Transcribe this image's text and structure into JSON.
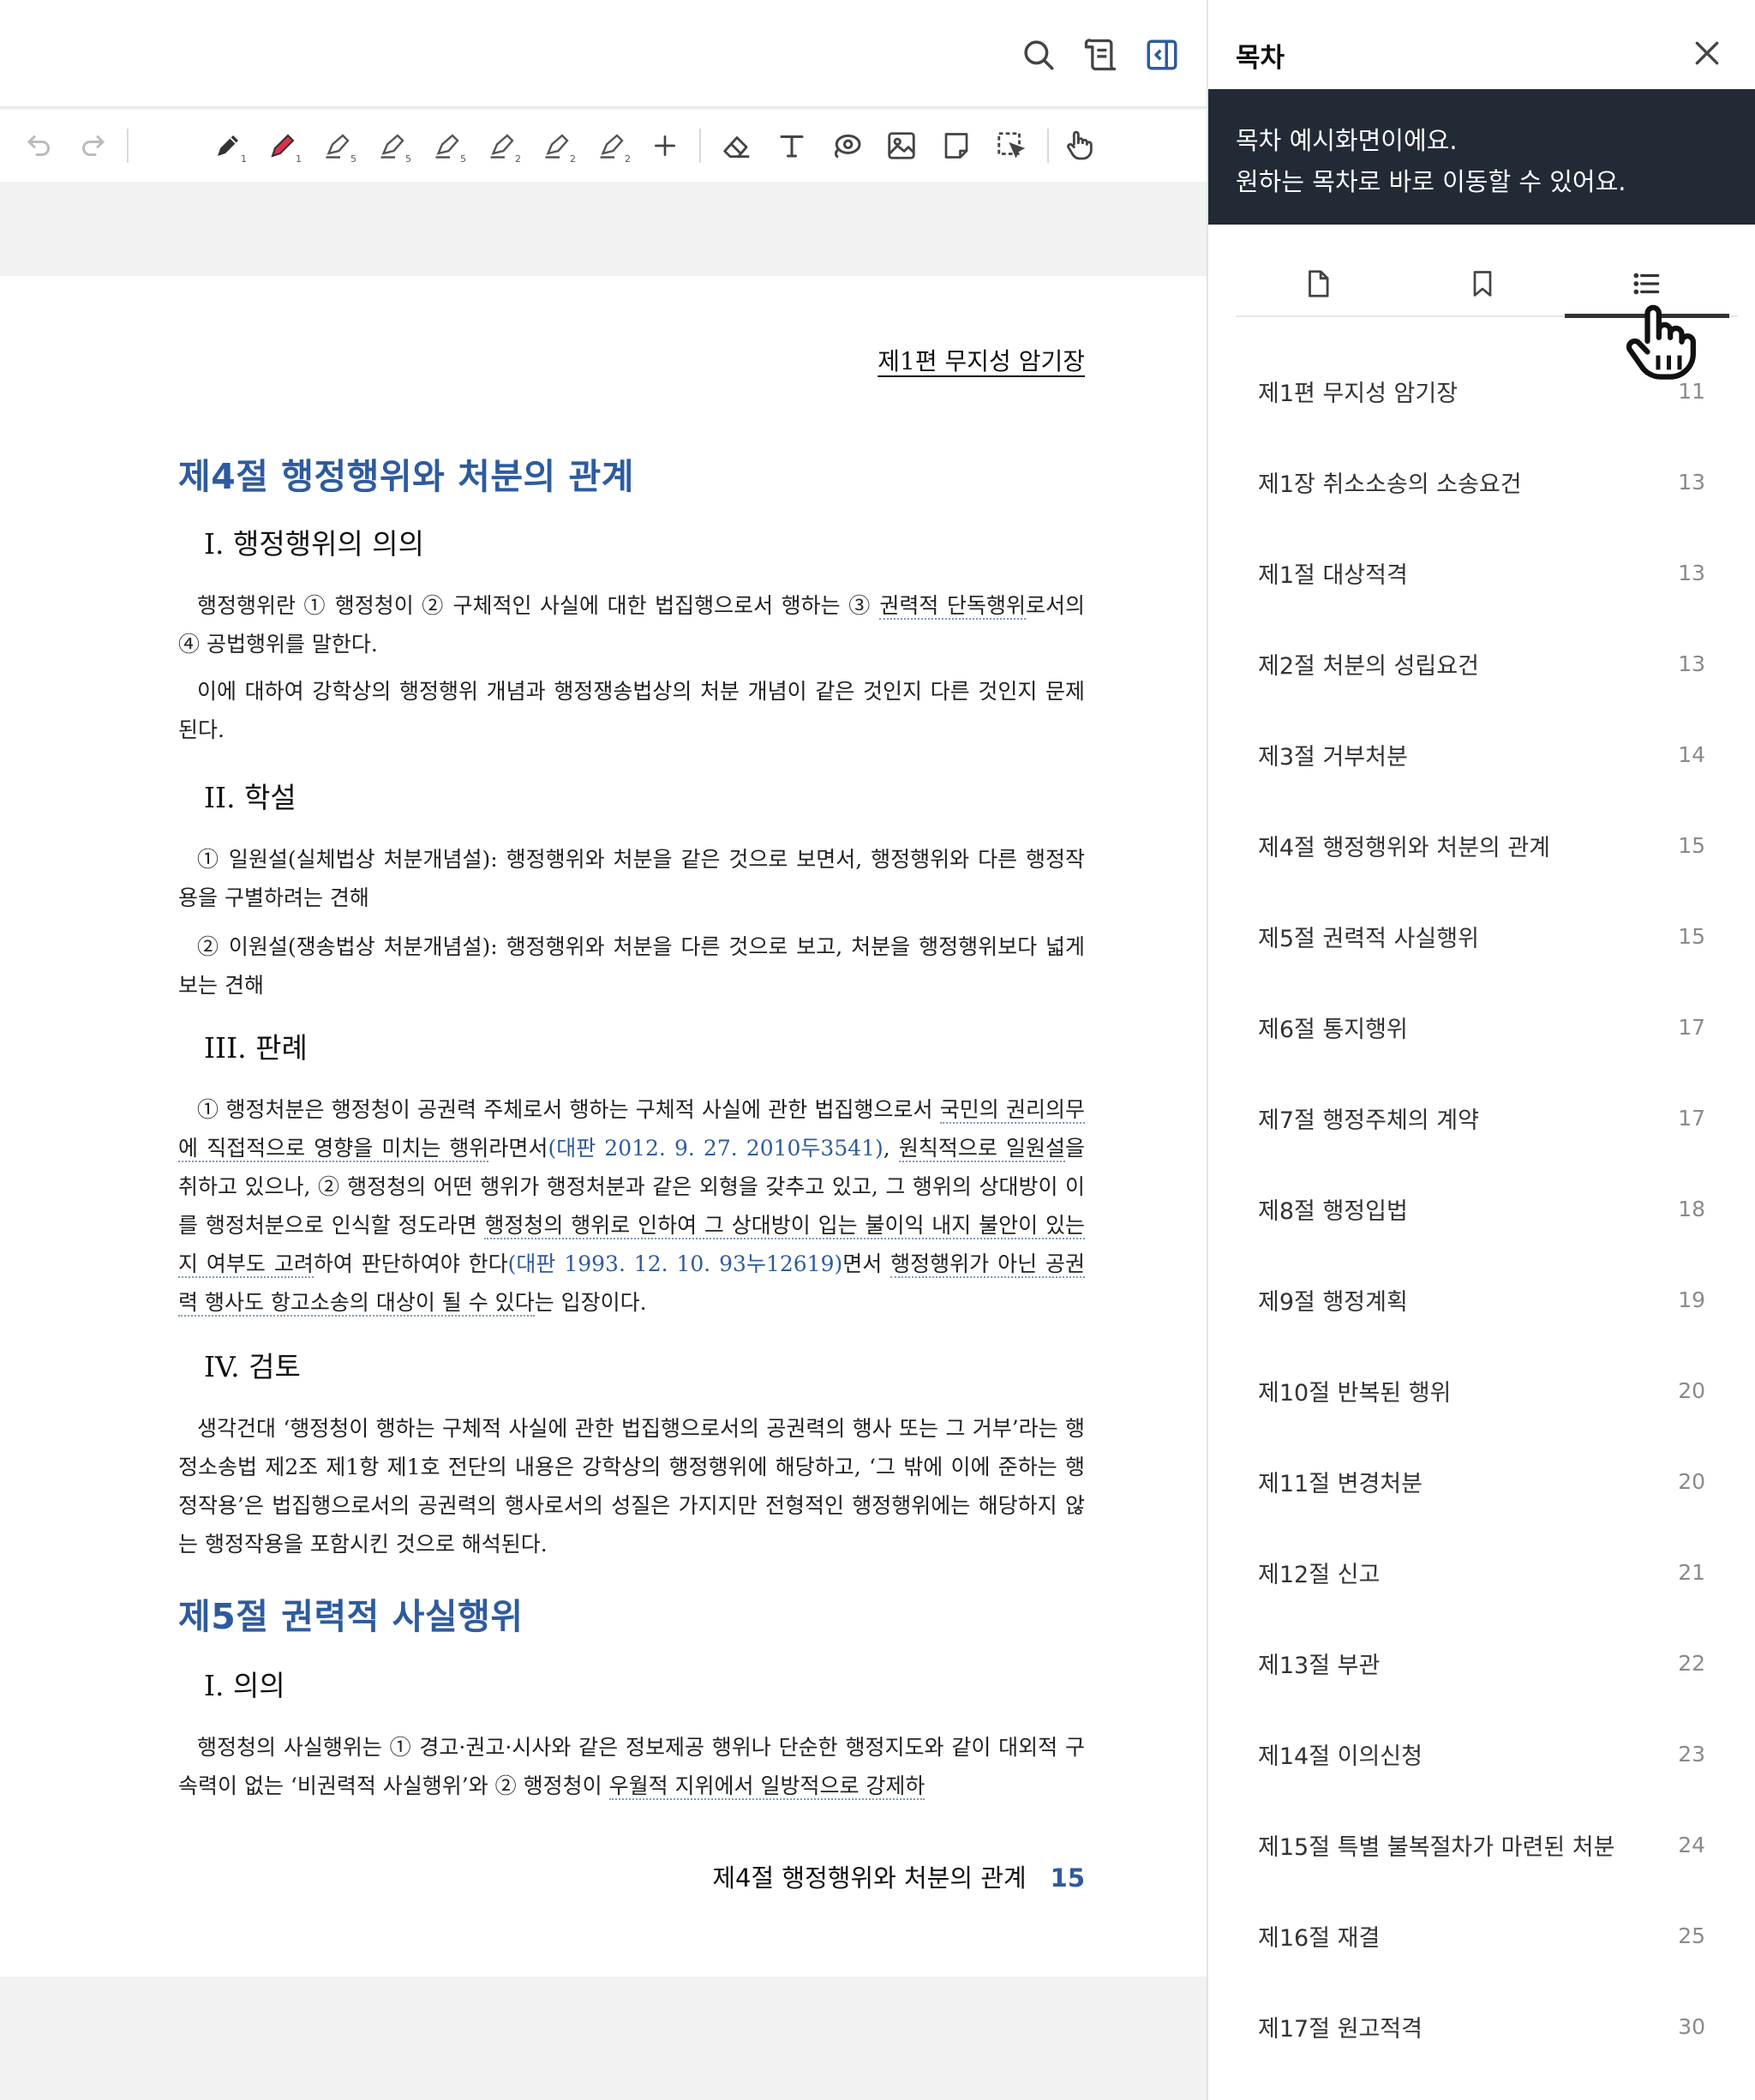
{
  "toolbar": {
    "pen_sizes": [
      "1",
      "1",
      "5",
      "5",
      "5",
      "2",
      "2",
      "2"
    ],
    "accent": "#2e5b9e",
    "red_pen": "#e0304a"
  },
  "page": {
    "header": "제1편 무지성 암기장",
    "sections": [
      {
        "title": "제4절 행정행위와 처분의 관계",
        "subsections": [
          {
            "title": "I. 행정행위의 의의",
            "paragraphs": [
              {
                "parts": [
                  {
                    "t": "행정행위란 ① 행정청이 ② 구체적인 사실에 대한 법집행으로서 행하는 ③ "
                  },
                  {
                    "t": "권력적 단독행위",
                    "u": 1
                  },
                  {
                    "t": "로서의 ④ 공법행위를 말한다."
                  }
                ]
              },
              {
                "parts": [
                  {
                    "t": "이에 대하여 강학상의 행정행위 개념과 행정쟁송법상의 처분 개념이 같은 것인지 다른 것인지 문제된다."
                  }
                ]
              }
            ]
          },
          {
            "title": "II. 학설",
            "paragraphs": [
              {
                "parts": [
                  {
                    "t": "① 일원설(실체법상 처분개념설): 행정행위와 처분을 같은 것으로 보면서, 행정행위와 다른 행정작용을 구별하려는 견해"
                  }
                ]
              },
              {
                "parts": [
                  {
                    "t": "② 이원설(쟁송법상 처분개념설): 행정행위와 처분을 다른 것으로 보고, 처분을 행정행위보다 넓게 보는 견해"
                  }
                ]
              }
            ]
          },
          {
            "title": "III. 판례",
            "paragraphs": [
              {
                "parts": [
                  {
                    "t": "① 행정처분은 행정청이 공권력 주체로서 행하는 구체적 사실에 관한 법집행으로서 "
                  },
                  {
                    "t": "국민의 권리의무에 직접적으로 영향을 미치는 행위",
                    "u": 1
                  },
                  {
                    "t": "라면서"
                  },
                  {
                    "t": "(대판 2012. 9. 27. 2010두3541)",
                    "r": 1
                  },
                  {
                    "t": ", "
                  },
                  {
                    "t": "원칙적으로 일원설",
                    "u": 1
                  },
                  {
                    "t": "을 취하고 있으나, ② 행정청의 어떤 행위가 행정처분과 같은 외형을 갖추고 있고, 그 행위의 상대방이 이를 행정처분으로 인식할 정도라면 "
                  },
                  {
                    "t": "행정청의 행위로 인하여 그 상대방이 입는 불이익 내지 불안이 있는지 여부도 고려",
                    "u": 1
                  },
                  {
                    "t": "하여 판단하여야 한다"
                  },
                  {
                    "t": "(대판 1993. 12. 10. 93누12619)",
                    "r": 1
                  },
                  {
                    "t": "면서 "
                  },
                  {
                    "t": "행정행위가 아닌 공권력 행사도 항고소송의 대상이 될 수 있다",
                    "u": 1
                  },
                  {
                    "t": "는 입장이다."
                  }
                ]
              }
            ]
          },
          {
            "title": "IV. 검토",
            "paragraphs": [
              {
                "parts": [
                  {
                    "t": "생각건대 ‘행정청이 행하는 구체적 사실에 관한 법집행으로서의 공권력의 행사 또는 그 거부’라는 행정소송법 제2조 제1항 제1호 전단의 내용은 강학상의 행정행위에 해당하고, ‘그 밖에 이에 준하는 행정작용’은 법집행으로서의 공권력의 행사로서의 성질은 가지지만 전형적인 행정행위에는 해당하지 않는 행정작용을 포함시킨 것으로 해석된다."
                  }
                ]
              }
            ]
          }
        ]
      },
      {
        "title": "제5절 권력적 사실행위",
        "subsections": [
          {
            "title": "I. 의의",
            "paragraphs": [
              {
                "parts": [
                  {
                    "t": "행정청의 사실행위는 ① 경고·권고·시사와 같은 정보제공 행위나 단순한 행정지도와 같이 대외적 구속력이 없는 ‘비권력적 사실행위’와 ② 행정청이 "
                  },
                  {
                    "t": "우월적 지위에서 일방적으로 강제하",
                    "u": 1
                  }
                ]
              }
            ]
          }
        ]
      }
    ],
    "footer": {
      "title": "제4절 행정행위와 처분의 관계",
      "page": "15"
    }
  },
  "panel": {
    "title": "목차",
    "tooltip": [
      "목차 예시화면이에요.",
      "원하는 목차로 바로 이동할 수 있어요."
    ],
    "toc": [
      {
        "label": "제1편 무지성 암기장",
        "page": "11"
      },
      {
        "label": "제1장 취소소송의 소송요건",
        "page": "13"
      },
      {
        "label": "제1절 대상적격",
        "page": "13"
      },
      {
        "label": "제2절 처분의 성립요건",
        "page": "13"
      },
      {
        "label": "제3절 거부처분",
        "page": "14"
      },
      {
        "label": "제4절 행정행위와 처분의 관계",
        "page": "15"
      },
      {
        "label": "제5절 권력적 사실행위",
        "page": "15"
      },
      {
        "label": "제6절 통지행위",
        "page": "17"
      },
      {
        "label": "제7절 행정주체의 계약",
        "page": "17"
      },
      {
        "label": "제8절 행정입법",
        "page": "18"
      },
      {
        "label": "제9절 행정계획",
        "page": "19"
      },
      {
        "label": "제10절 반복된 행위",
        "page": "20"
      },
      {
        "label": "제11절 변경처분",
        "page": "20"
      },
      {
        "label": "제12절 신고",
        "page": "21"
      },
      {
        "label": "제13절 부관",
        "page": "22"
      },
      {
        "label": "제14절 이의신청",
        "page": "23"
      },
      {
        "label": "제15절 특별 불복절차가 마련된 처분",
        "page": "24"
      },
      {
        "label": "제16절 재결",
        "page": "25"
      },
      {
        "label": "제17절 원고적격",
        "page": "30"
      }
    ]
  }
}
